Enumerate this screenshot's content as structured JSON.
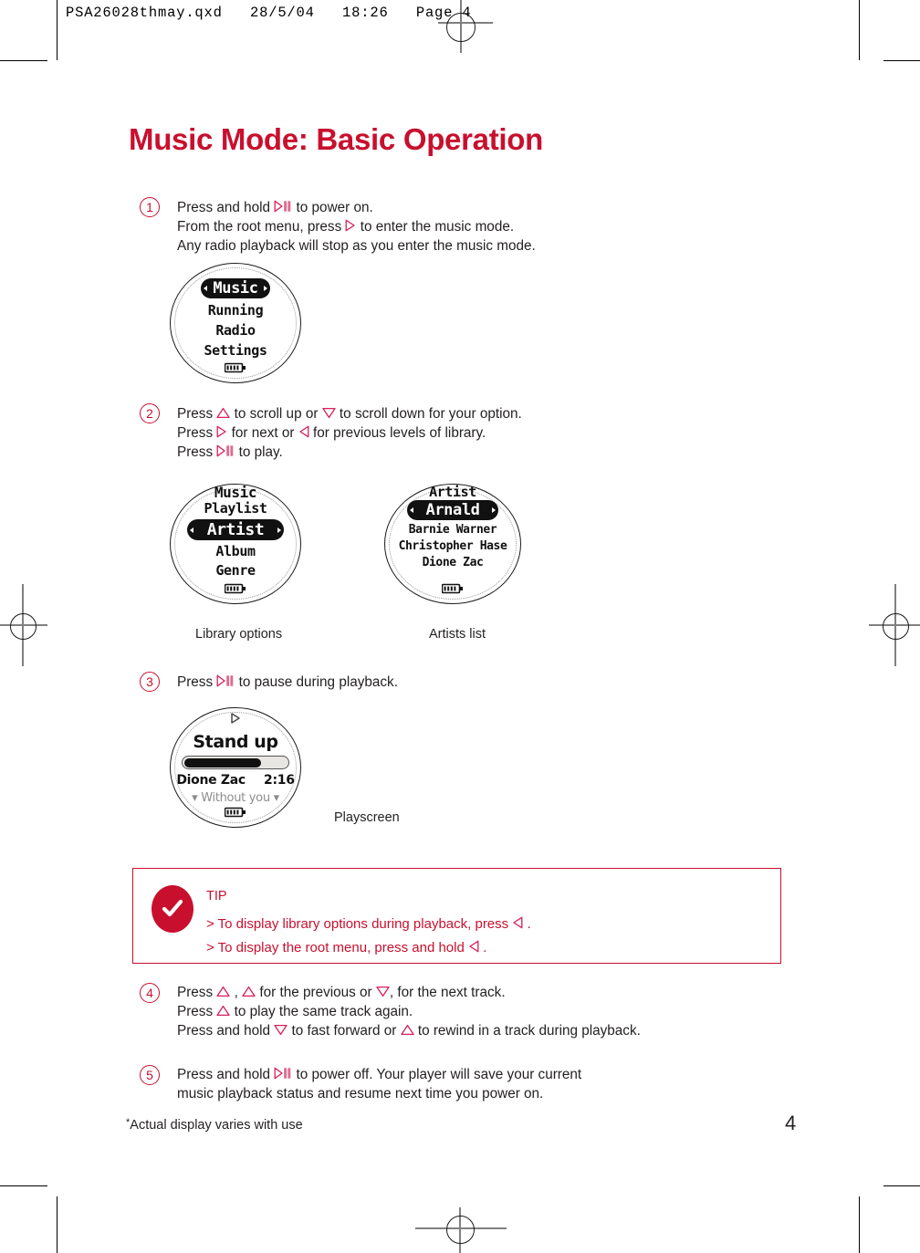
{
  "prepress": {
    "header": "PSA26028thmay.qxd   28/5/04   18:26   Page 4"
  },
  "title": "Music Mode: Basic Operation",
  "accent_color": "#c8102e",
  "text_color": "#231f20",
  "steps": [
    {
      "number": "1",
      "lines": [
        [
          {
            "t": "text",
            "v": "Press and hold "
          },
          {
            "t": "icon",
            "v": "play-pause-icon"
          },
          {
            "t": "text",
            "v": " to power on."
          }
        ],
        [
          {
            "t": "text",
            "v": "From the root menu, press "
          },
          {
            "t": "icon",
            "v": "right-triangle-icon"
          },
          {
            "t": "text",
            "v": " to enter the music mode."
          }
        ],
        [
          {
            "t": "text",
            "v": "Any radio playback will stop as you enter the music mode."
          }
        ]
      ]
    },
    {
      "number": "2",
      "lines": [
        [
          {
            "t": "text",
            "v": "Press "
          },
          {
            "t": "icon",
            "v": "up-triangle-icon"
          },
          {
            "t": "text",
            "v": " to scroll up or "
          },
          {
            "t": "icon",
            "v": "down-triangle-icon"
          },
          {
            "t": "text",
            "v": " to scroll down for your option."
          }
        ],
        [
          {
            "t": "text",
            "v": "Press "
          },
          {
            "t": "icon",
            "v": "right-triangle-icon"
          },
          {
            "t": "text",
            "v": " for next or "
          },
          {
            "t": "icon",
            "v": "left-triangle-icon"
          },
          {
            "t": "text",
            "v": " for previous levels of library."
          }
        ],
        [
          {
            "t": "text",
            "v": "Press "
          },
          {
            "t": "icon",
            "v": "play-pause-icon"
          },
          {
            "t": "text",
            "v": " to play."
          }
        ]
      ]
    },
    {
      "number": "3",
      "lines": [
        [
          {
            "t": "text",
            "v": "Press "
          },
          {
            "t": "icon",
            "v": "play-pause-icon"
          },
          {
            "t": "text",
            "v": " to pause during playback."
          }
        ]
      ]
    },
    {
      "number": "4",
      "lines": [
        [
          {
            "t": "text",
            "v": "Press "
          },
          {
            "t": "icon",
            "v": "up-triangle-icon"
          },
          {
            "t": "text",
            "v": " , "
          },
          {
            "t": "icon",
            "v": "up-triangle-icon"
          },
          {
            "t": "text",
            "v": " for the previous or "
          },
          {
            "t": "icon",
            "v": "down-triangle-icon"
          },
          {
            "t": "text",
            "v": ", for the next track."
          }
        ],
        [
          {
            "t": "text",
            "v": "Press "
          },
          {
            "t": "icon",
            "v": "up-triangle-icon"
          },
          {
            "t": "text",
            "v": " to play the same track again."
          }
        ],
        [
          {
            "t": "text",
            "v": "Press and hold "
          },
          {
            "t": "icon",
            "v": "down-triangle-icon"
          },
          {
            "t": "text",
            "v": " to fast forward or "
          },
          {
            "t": "icon",
            "v": "up-triangle-icon"
          },
          {
            "t": "text",
            "v": " to rewind in a track during playback."
          }
        ]
      ]
    },
    {
      "number": "5",
      "lines": [
        [
          {
            "t": "text",
            "v": "Press and hold "
          },
          {
            "t": "icon",
            "v": "play-pause-icon"
          },
          {
            "t": "text",
            "v": " to power off.  Your player will save your current"
          }
        ],
        [
          {
            "t": "text",
            "v": "music playback status and resume next time you power on."
          }
        ]
      ]
    }
  ],
  "screens": {
    "root_menu": {
      "caption": "",
      "rows": [
        {
          "label": "Music",
          "selected": true
        },
        {
          "label": "Running",
          "selected": false
        },
        {
          "label": "Radio",
          "selected": false
        },
        {
          "label": "Settings",
          "selected": false
        }
      ],
      "battery": "battery-icon"
    },
    "library_options": {
      "caption": "Library options",
      "header": "Music",
      "rows": [
        {
          "label": "Playlist",
          "selected": false
        },
        {
          "label": "Artist",
          "selected": true
        },
        {
          "label": "Album",
          "selected": false
        },
        {
          "label": "Genre",
          "selected": false
        }
      ],
      "battery": "battery-icon"
    },
    "artists_list": {
      "caption": "Artists list",
      "header": "Artist",
      "rows": [
        {
          "label": "Arnald",
          "selected": true
        },
        {
          "label": "Barnie Warner",
          "selected": false
        },
        {
          "label": "Christopher Hase",
          "selected": false
        },
        {
          "label": "Dione Zac",
          "selected": false
        }
      ],
      "battery": "battery-icon"
    },
    "playscreen": {
      "caption": "Playscreen",
      "status_icon": "play-icon",
      "track_title": "Stand up",
      "progress_percent": 75,
      "artist": "Dione Zac",
      "time": "2:16",
      "next_track": "Without you",
      "battery": "battery-icon"
    }
  },
  "tip": {
    "check_icon": "checkmark-icon",
    "label": "TIP",
    "lines": [
      [
        {
          "t": "text",
          "v": "> To display library options during playback, press  "
        },
        {
          "t": "icon",
          "v": "left-triangle-icon"
        },
        {
          "t": "text",
          "v": " ."
        }
      ],
      [
        {
          "t": "text",
          "v": "> To display the root menu, press and hold "
        },
        {
          "t": "icon",
          "v": "left-triangle-icon"
        },
        {
          "t": "text",
          "v": " ."
        }
      ]
    ]
  },
  "footer": {
    "note_star": "*",
    "note": "Actual display varies with use",
    "page_number": "4"
  }
}
